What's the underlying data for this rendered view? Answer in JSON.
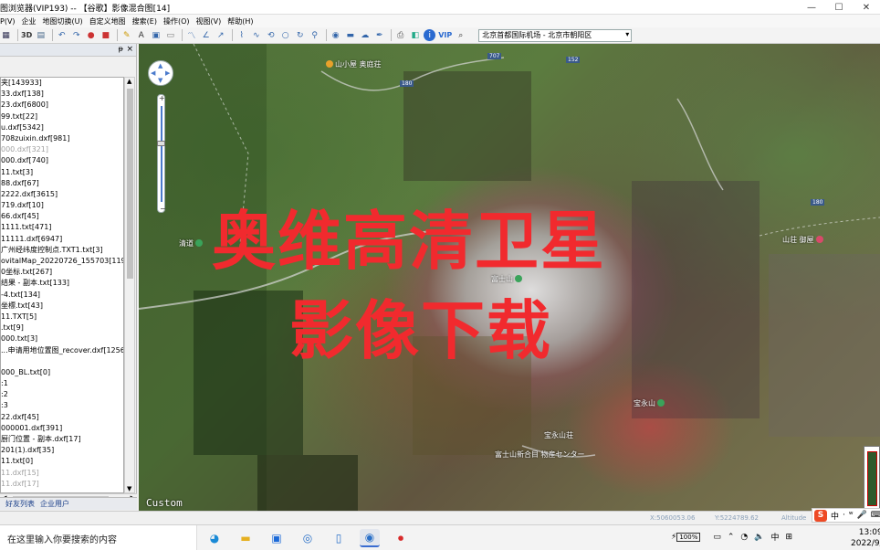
{
  "window": {
    "title": "图浏览器(VIP193) -- 【谷歌】影像混合图[14]",
    "controls": [
      "—",
      "☐",
      "✕"
    ]
  },
  "menu": [
    "P(V)",
    "企业",
    "地图切换(U)",
    "自定义地图",
    "搜索(E)",
    "操作(O)",
    "视图(V)",
    "帮助(H)"
  ],
  "toolbar": {
    "label_3d": "3D",
    "label_vip": "VIP",
    "location": "北京首都国际机场 - 北京市朝阳区"
  },
  "left_panel": {
    "pin_glyph": "ᵽ",
    "close_glyph": "×",
    "files": [
      {
        "name": "夹[143933]",
        "gray": false
      },
      {
        "name": "33.dxf[138]",
        "gray": false
      },
      {
        "name": "23.dxf[6800]",
        "gray": false
      },
      {
        "name": "99.txt[22]",
        "gray": false
      },
      {
        "name": "u.dxf[5342]",
        "gray": false
      },
      {
        "name": "708zuixin.dxf[981]",
        "gray": false
      },
      {
        "name": "000.dxf[321]",
        "gray": true
      },
      {
        "name": "000.dxf[740]",
        "gray": false
      },
      {
        "name": "11.txt[3]",
        "gray": false
      },
      {
        "name": "88.dxf[67]",
        "gray": false
      },
      {
        "name": "2222.dxf[3615]",
        "gray": false
      },
      {
        "name": "719.dxf[10]",
        "gray": false
      },
      {
        "name": "66.dxf[45]",
        "gray": false
      },
      {
        "name": "1111.txt[471]",
        "gray": false
      },
      {
        "name": "11111.dxf[6947]",
        "gray": false
      },
      {
        "name": "广州经纬度控制点.TXT1.txt[3]",
        "gray": false
      },
      {
        "name": "ovitalMap_20220726_155703[119]",
        "gray": false
      },
      {
        "name": "0坐标.txt[267]",
        "gray": false
      },
      {
        "name": "结果 - 副本.txt[133]",
        "gray": false
      },
      {
        "name": "-4.txt[134]",
        "gray": false
      },
      {
        "name": "坐標.txt[43]",
        "gray": false
      },
      {
        "name": "11.TXT[5]",
        "gray": false
      },
      {
        "name": ".txt[9]",
        "gray": false
      },
      {
        "name": "000.txt[3]",
        "gray": false
      },
      {
        "name": "...申请用地位置图_recover.dxf[1256]",
        "gray": false
      },
      {
        "name": "",
        "gray": false
      },
      {
        "name": "000_BL.txt[0]",
        "gray": false
      },
      {
        "name": ":1",
        "gray": false
      },
      {
        "name": ":2",
        "gray": false
      },
      {
        "name": ":3",
        "gray": false
      },
      {
        "name": "22.dxf[45]",
        "gray": false
      },
      {
        "name": "000001.dxf[391]",
        "gray": false
      },
      {
        "name": "厨门位置 - 副本.dxf[17]",
        "gray": false
      },
      {
        "name": "201(1).dxf[35]",
        "gray": false
      },
      {
        "name": "11.txt[0]",
        "gray": false
      },
      {
        "name": "11.dxf[15]",
        "gray": true
      },
      {
        "name": "11.dxf[17]",
        "gray": true
      }
    ],
    "tabs": [
      "好友列表",
      "企业用户"
    ]
  },
  "map": {
    "overlay_line1": "奥维高清卫星",
    "overlay_line2": "影像下载",
    "watermark": "Custom",
    "pois": [
      {
        "label": "山小屋 奥庭荘",
        "color": "#e8a12b"
      },
      {
        "label": "清道",
        "color": "#3aa35a"
      },
      {
        "label": "富士山",
        "color": "#3aa35a"
      },
      {
        "label": "宝永山",
        "color": "#3aa35a"
      },
      {
        "label": "宝永山荘",
        "color": "#3aa35a"
      },
      {
        "label": "山荘 御屋",
        "color": "#d84a6a"
      },
      {
        "label": "富士山新合目 物産センター",
        "color": "#4a7acc"
      }
    ],
    "roads": [
      "707",
      "180",
      "152",
      "180"
    ],
    "nav": {
      "up": "▲",
      "down": "▼",
      "left": "◀",
      "right": "▶",
      "plus": "+",
      "minus": "−"
    }
  },
  "status": {
    "x": "X:5060053.06",
    "y": "Y:5224789.62",
    "alt": "Altitude"
  },
  "ime": {
    "logo": "S",
    "items": [
      "中",
      "·",
      "ʷ",
      "🎤",
      "⌨"
    ]
  },
  "taskbar": {
    "search_placeholder": "在这里输入你要搜索的内容",
    "tray_battery": "100%",
    "tray_lang": "中",
    "time": "13:09",
    "date": "2022/9/"
  }
}
